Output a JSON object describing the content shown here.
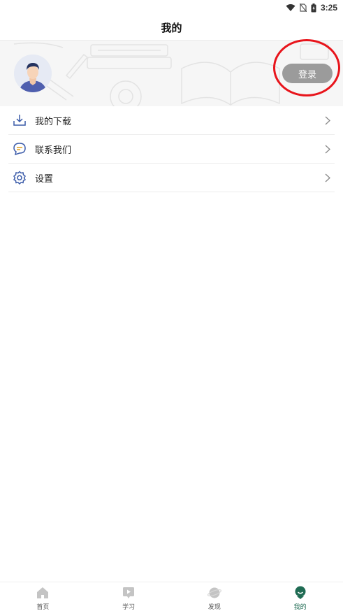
{
  "status_bar": {
    "time": "3:25"
  },
  "header": {
    "title": "我的"
  },
  "profile": {
    "login_label": "登录"
  },
  "menu": {
    "items": [
      {
        "label": "我的下载",
        "icon": "download-icon"
      },
      {
        "label": "联系我们",
        "icon": "chat-bubble-icon"
      },
      {
        "label": "设置",
        "icon": "gear-icon"
      }
    ]
  },
  "tabs": [
    {
      "label": "首页",
      "icon": "home-icon",
      "active": false
    },
    {
      "label": "学习",
      "icon": "play-book-icon",
      "active": false
    },
    {
      "label": "发现",
      "icon": "planet-icon",
      "active": false
    },
    {
      "label": "我的",
      "icon": "profile-icon",
      "active": true
    }
  ],
  "colors": {
    "accent": "#1f6b53",
    "login_button": "#9b9b9b",
    "highlight": "#e8141b"
  }
}
